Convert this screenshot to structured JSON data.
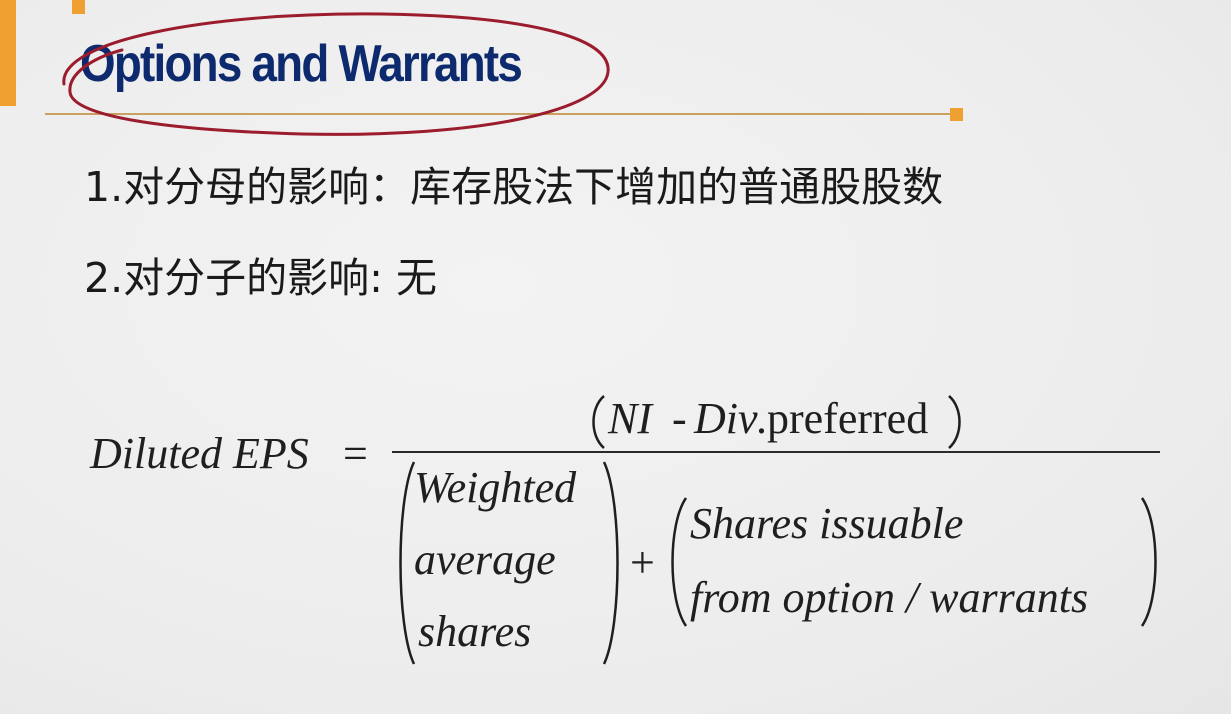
{
  "slide": {
    "title": "Options and Warrants",
    "bullets": [
      "1.对分母的影响：库存股法下增加的普通股股数",
      "2.对分子的影响: 无"
    ]
  },
  "formula": {
    "lhs": "Diluted EPS",
    "equals": "=",
    "numerator_ni": "NI",
    "numerator_minus": "-",
    "numerator_div": "Div",
    "numerator_preferred": ".preferred",
    "den_term1": [
      "Weighted",
      "average",
      "shares"
    ],
    "plus": "+",
    "den_term2": [
      "Shares issuable",
      "from option / warrants"
    ]
  },
  "colors": {
    "title": "#0e2a6e",
    "accent_orange": "#f0a030",
    "circle_red": "#9b1c2c",
    "text": "#1a1a1a"
  }
}
